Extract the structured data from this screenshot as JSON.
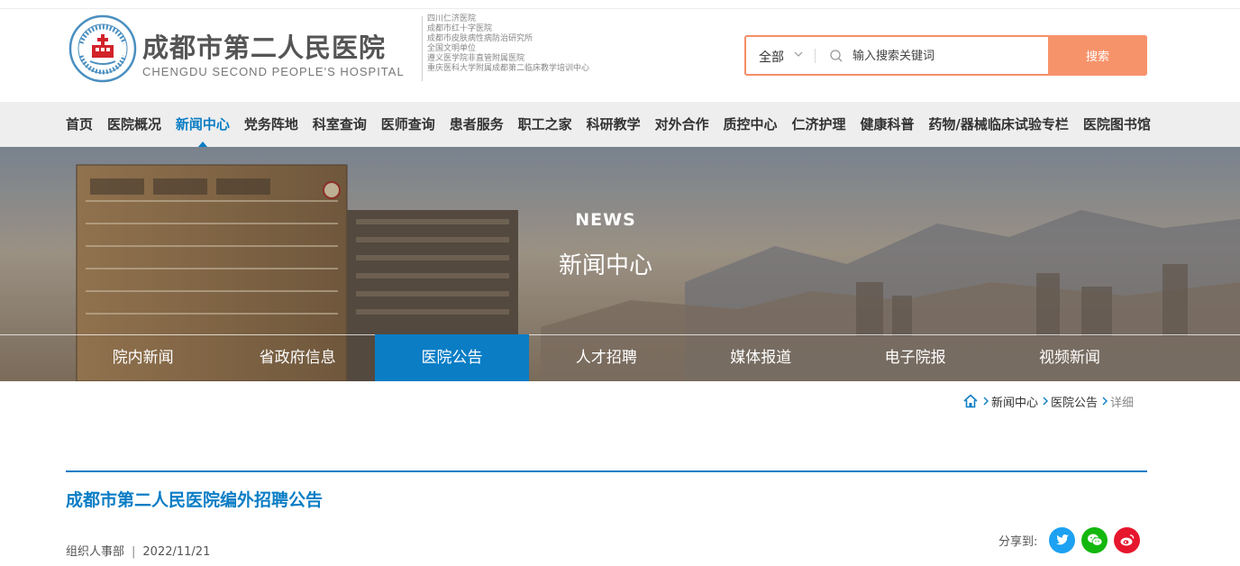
{
  "header": {
    "logo_cn": "成都市第二人民医院",
    "logo_en": "CHENGDU SECOND PEOPLE'S HOSPITAL",
    "seal_text": "成都市第二人民医院",
    "sub_names": [
      "四川仁济医院",
      "成都市红十字医院",
      "成都市皮肤病性病防治研究所",
      "全国文明单位",
      "遵义医学院非直管附属医院",
      "重庆医科大学附属成都第二临床教学培训中心"
    ]
  },
  "search": {
    "category": "全部",
    "placeholder": "输入搜索关键词",
    "button": "搜索"
  },
  "nav": {
    "items": [
      "首页",
      "医院概况",
      "新闻中心",
      "党务阵地",
      "科室查询",
      "医师查询",
      "患者服务",
      "职工之家",
      "科研教学",
      "对外合作",
      "质控中心",
      "仁济护理",
      "健康科普",
      "药物/器械临床试验专栏",
      "医院图书馆"
    ],
    "active": "新闻中心"
  },
  "banner": {
    "en": "NEWS",
    "cn": "新闻中心"
  },
  "subnav": {
    "items": [
      "院内新闻",
      "省政府信息",
      "医院公告",
      "人才招聘",
      "媒体报道",
      "电子院报",
      "视频新闻"
    ],
    "active": "医院公告"
  },
  "breadcrumb": {
    "items": [
      "新闻中心",
      "医院公告",
      "详细"
    ]
  },
  "article": {
    "title": "成都市第二人民医院编外招聘公告",
    "author": "组织人事部",
    "date": "2022/11/21"
  },
  "share": {
    "label": "分享到:",
    "buttons": [
      "twitter-icon",
      "wechat-icon",
      "weibo-icon"
    ]
  },
  "colors": {
    "accent": "#0a7dc5",
    "search_button": "#f7936b",
    "twitter": "#1da1f2",
    "wechat": "#13b70f",
    "weibo": "#e6162d"
  }
}
